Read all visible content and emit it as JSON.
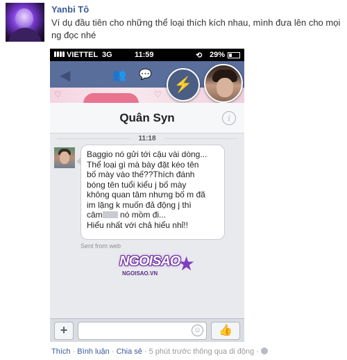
{
  "post": {
    "author": "Yanbi Tô",
    "text": "Ví dụ đầu tiên cho những thể loại thích kích nhau, mình đưa lên cho mọi ng đọc nhé"
  },
  "phone": {
    "status_bar": {
      "carrier": "VIETTEL",
      "network": "3G",
      "time": "11:59",
      "battery": "29%",
      "battery_level": 0.29
    },
    "chat_title": "Quân Syn",
    "message_time": "11:18",
    "message_lines": [
      "Baggio nó gửi tới cậu vài dòng...",
      "Thể loại gì mà bày đặt kéo tên",
      "bố mày vào thế??Thích đánh",
      "bóng tên tuổi kiểu j bố mày",
      "không quan tâm nhưng bố m đã",
      "im lặng k muốn đả động j thì",
      "câm",
      "nó mồm đi...",
      "Hiểu nhất với chả hiểu nhỉ!!"
    ],
    "sent_from": "Sent from web",
    "composer": {
      "plus": "+",
      "placeholder": "",
      "like_icon": "thumbs-up-icon"
    },
    "icons": {
      "back": "back-arrow-icon",
      "friends": "friends-icon",
      "messages": "messages-icon",
      "messenger": "messenger-chat-head-icon",
      "info": "info-icon"
    }
  },
  "watermark": {
    "brand": "NGOISAO",
    "site": "NGOISAO.VN"
  },
  "footer": {
    "like": "Thích",
    "sep1": " · ",
    "comment": "Bình luận",
    "sep2": " · ",
    "share": "Chia sẻ",
    "meta": " · 5 phút trước thông qua di động · "
  },
  "colors": {
    "facebook_blue": "#3b5998",
    "nav_blue": "#5a6e9b"
  }
}
